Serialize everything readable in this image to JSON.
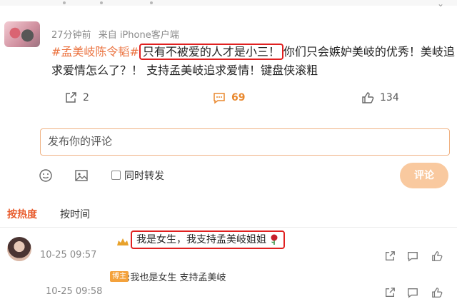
{
  "post": {
    "time": "27分钟前",
    "source": "来自 iPhone客户端",
    "hashtag": "#孟美岐陈令韬#",
    "highlight": "只有不被爱的人才是小三！",
    "text_rest": "你们只会嫉妒美岐的优秀！美岐追求爱情怎么了？！ 支持孟美岐追求爱情！键盘侠滚粗"
  },
  "actions": {
    "share_count": "2",
    "comment_count": "69",
    "like_count": "134",
    "comment_color": "#e9892f"
  },
  "composer": {
    "placeholder": "发布你的评论",
    "also_repost_label": "同时转发",
    "submit_label": "评论",
    "submit_color": "#f9c99f"
  },
  "sort": {
    "hot_label": "按热度",
    "time_label": "按时间",
    "active_color": "#e85b2c"
  },
  "comments": [
    {
      "text": "我是女生，我支持孟美岐姐姐",
      "emoji": "rose-icon",
      "time": "10-25 09:57",
      "reply": {
        "badge": "博主",
        "text": ":我也是女生 支持孟美岐",
        "time": "10-25 09:58"
      }
    }
  ],
  "icons": [
    "share-icon",
    "comment-icon",
    "like-icon",
    "emoji-icon",
    "image-icon",
    "checkbox-icon",
    "rose-icon",
    "reply-icon"
  ],
  "highlight_border_color": "#e02020"
}
